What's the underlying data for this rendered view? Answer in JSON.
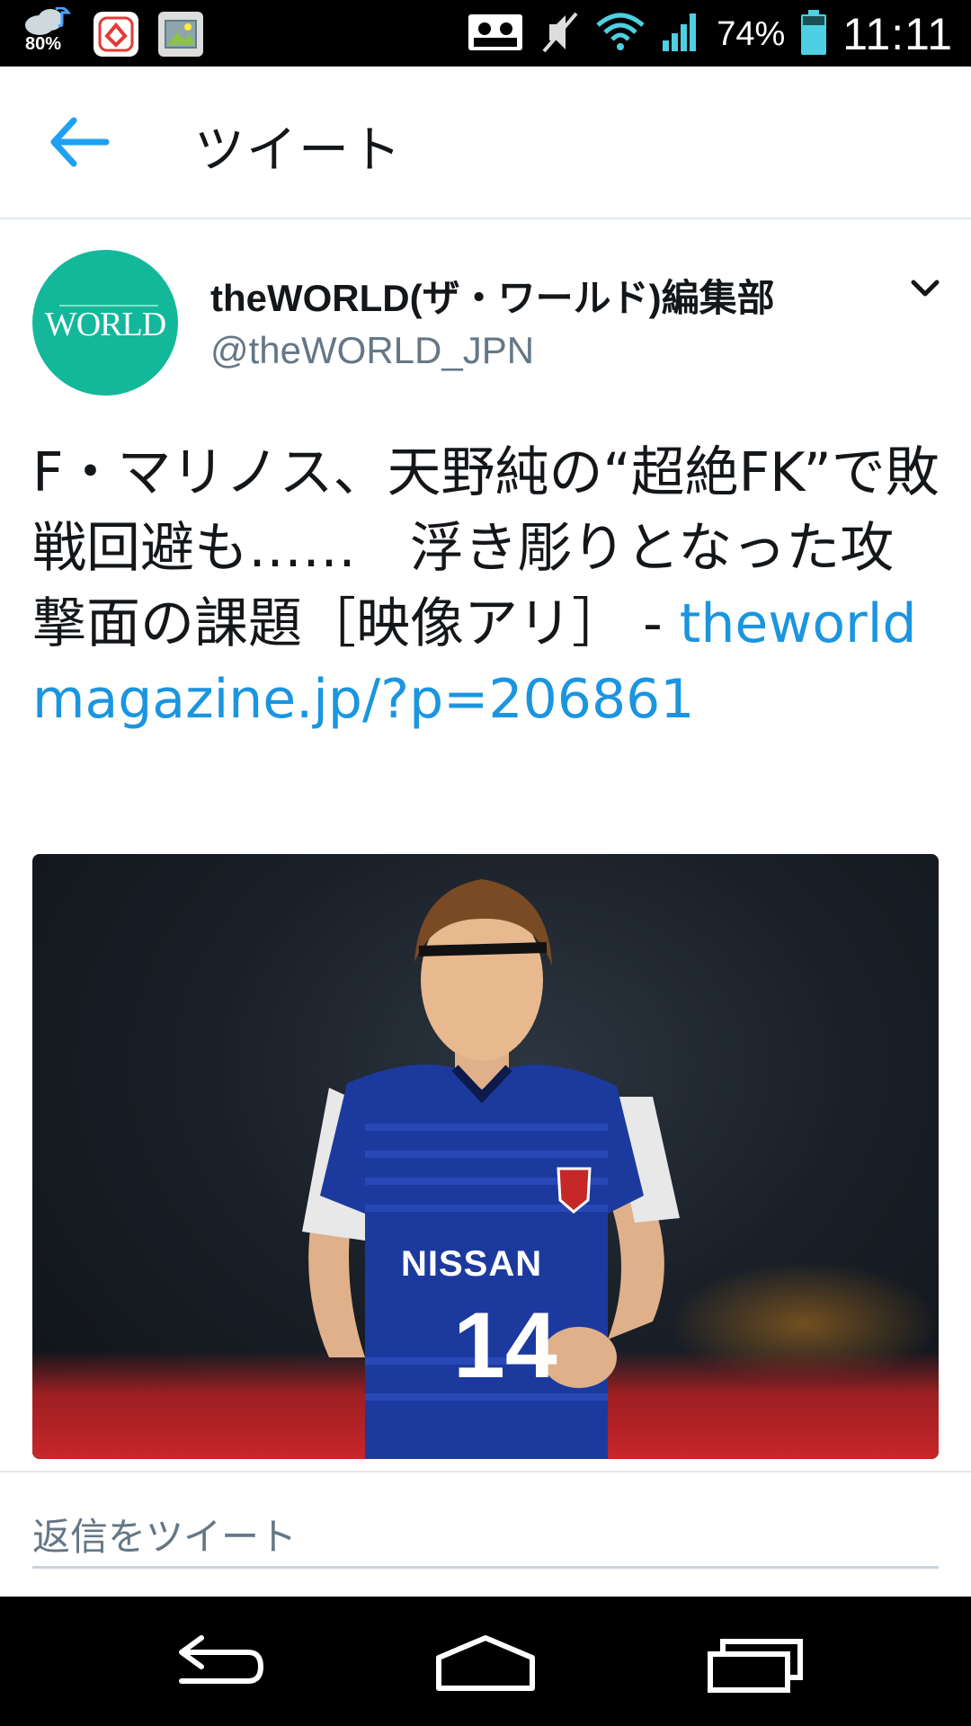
{
  "status_bar": {
    "weather_percent": "80%",
    "battery_percent": "74%",
    "time": "11:11",
    "icons": [
      "weather-icon",
      "app-icon",
      "gallery-icon",
      "notification-icon",
      "mute-icon",
      "wifi-icon",
      "signal-icon",
      "battery-icon"
    ]
  },
  "toolbar": {
    "title": "ツイート",
    "back_icon": "back-arrow-icon"
  },
  "tweet": {
    "avatar_logo_text": "theWORLD",
    "display_name": "theWORLD(ザ・ワールド)編集部",
    "handle": "@theWORLD_JPN",
    "text": "F・マリノス、天野純の“超絶FK”で敗戦回避も……　浮き彫りとなった攻撃面の課題［映像アリ］ - ",
    "link": "theworldmagazine.jp/?p=206861",
    "media": {
      "jersey_sponsor": "NISSAN",
      "jersey_number": "14"
    },
    "menu_icon": "chevron-down-icon"
  },
  "reply": {
    "placeholder": "返信をツイート"
  },
  "nav": {
    "icons": [
      "back-icon",
      "home-icon",
      "recents-icon"
    ]
  },
  "colors": {
    "accent": "#1b95e0",
    "avatar_bg": "#13b89a",
    "text_primary": "#14171a",
    "text_secondary": "#657786"
  }
}
